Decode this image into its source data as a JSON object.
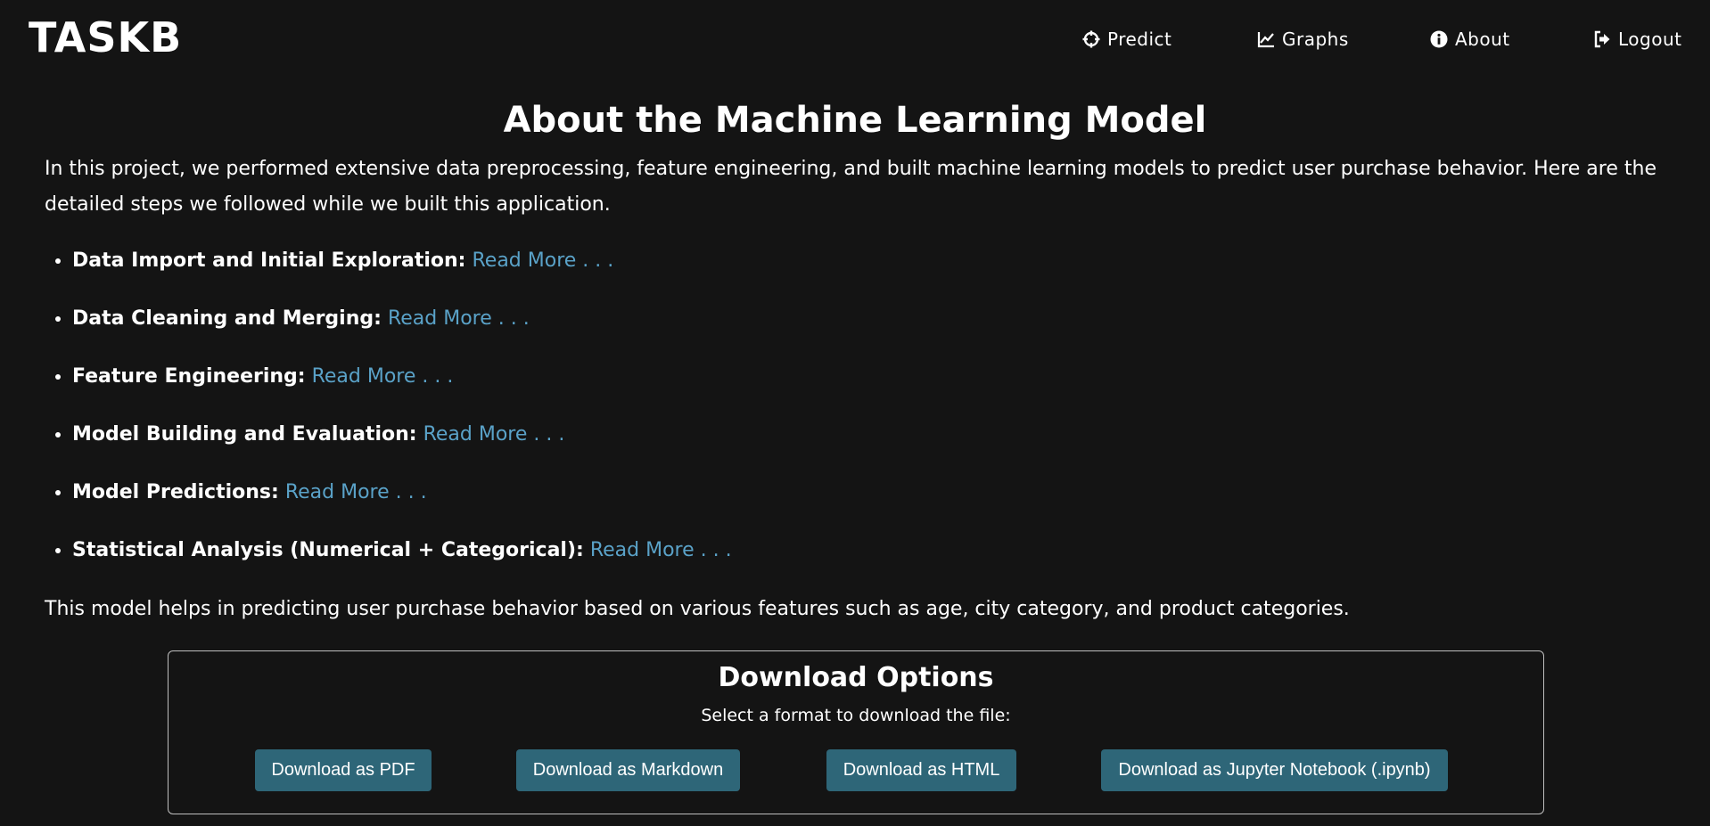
{
  "header": {
    "logo": "TASKB",
    "nav": [
      {
        "label": "Predict",
        "icon": "crosshair-icon"
      },
      {
        "label": "Graphs",
        "icon": "line-chart-icon"
      },
      {
        "label": "About",
        "icon": "info-circle-icon"
      },
      {
        "label": "Logout",
        "icon": "logout-icon"
      }
    ]
  },
  "main": {
    "title": "About the Machine Learning Model",
    "intro": "In this project, we performed extensive data preprocessing, feature engineering, and built machine learning models to predict user purchase behavior. Here are the detailed steps we followed while we built this application.",
    "steps": [
      {
        "label": "Data Import and Initial Exploration:",
        "link": "Read More . . ."
      },
      {
        "label": "Data Cleaning and Merging:",
        "link": "Read More . . ."
      },
      {
        "label": "Feature Engineering:",
        "link": "Read More . . ."
      },
      {
        "label": "Model Building and Evaluation:",
        "link": "Read More . . ."
      },
      {
        "label": "Model Predictions:",
        "link": "Read More . . ."
      },
      {
        "label": "Statistical Analysis (Numerical + Categorical):",
        "link": "Read More . . ."
      }
    ],
    "summary": "This model helps in predicting user purchase behavior based on various features such as age, city category, and product categories."
  },
  "download": {
    "title": "Download Options",
    "subtitle": "Select a format to download the file:",
    "buttons": [
      "Download as PDF",
      "Download as Markdown",
      "Download as HTML",
      "Download as Jupyter Notebook (.ipynb)"
    ]
  },
  "colors": {
    "background": "#141414",
    "link": "#5aa2c8",
    "button": "#2e6678"
  }
}
